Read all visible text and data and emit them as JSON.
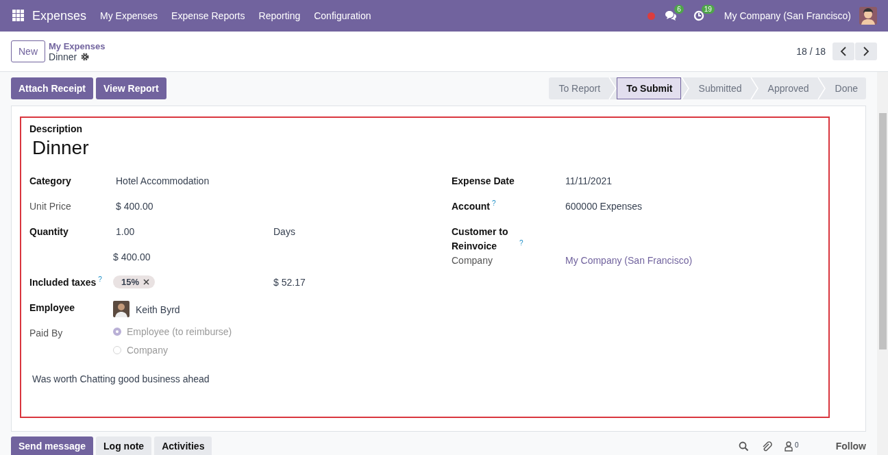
{
  "navbar": {
    "app_name": "Expenses",
    "menu": [
      "My Expenses",
      "Expense Reports",
      "Reporting",
      "Configuration"
    ],
    "chat_count": "6",
    "activity_count": "19",
    "company": "My Company (San Francisco)"
  },
  "control_panel": {
    "new_button": "New",
    "breadcrumb_parent": "My Expenses",
    "breadcrumb_current": "Dinner",
    "pager": "18 / 18"
  },
  "actions": [
    "Attach Receipt",
    "View Report"
  ],
  "stages": [
    {
      "label": "To Report",
      "selected": false
    },
    {
      "label": "To Submit",
      "selected": true
    },
    {
      "label": "Submitted",
      "selected": false
    },
    {
      "label": "Approved",
      "selected": false
    },
    {
      "label": "Done",
      "selected": false
    }
  ],
  "form": {
    "description_label": "Description",
    "title": "Dinner",
    "left_fields": [
      {
        "kind": "text",
        "label": "Category",
        "required": true,
        "value": "Hotel Accommodation"
      },
      {
        "kind": "text",
        "label": "Unit Price",
        "required": false,
        "value": "$ 400.00"
      },
      {
        "kind": "quantity",
        "label": "Quantity",
        "required": true,
        "value": "1.00",
        "unit": "Days"
      },
      {
        "kind": "total",
        "value": "$ 400.00"
      },
      {
        "kind": "taxes",
        "label": "Included taxes",
        "required": true,
        "help": "?",
        "tag": "15%",
        "amount": "$ 52.17"
      },
      {
        "kind": "employee",
        "label": "Employee",
        "required": true,
        "value": "Keith Byrd"
      },
      {
        "kind": "radio",
        "label": "Paid By",
        "required": false,
        "options": [
          {
            "label": "Employee (to reimburse)",
            "selected": true
          },
          {
            "label": "Company",
            "selected": false
          }
        ]
      }
    ],
    "right_fields": [
      {
        "kind": "text",
        "label": "Expense Date",
        "required": true,
        "value": "11/11/2021"
      },
      {
        "kind": "text",
        "label": "Account",
        "required": true,
        "help": "?",
        "value": "600000 Expenses"
      },
      {
        "kind": "empty",
        "label": "Customer to Reinvoice",
        "required": true,
        "help": "?"
      },
      {
        "kind": "link",
        "label": "Company",
        "required": false,
        "value": "My Company (San Francisco)"
      }
    ],
    "note": "Was worth Chatting good business ahead"
  },
  "chatter": {
    "buttons": [
      {
        "label": "Send message",
        "primary": true
      },
      {
        "label": "Log note",
        "primary": false
      },
      {
        "label": "Activities",
        "primary": false
      }
    ],
    "follower_count": "0",
    "follow": "Follow"
  }
}
